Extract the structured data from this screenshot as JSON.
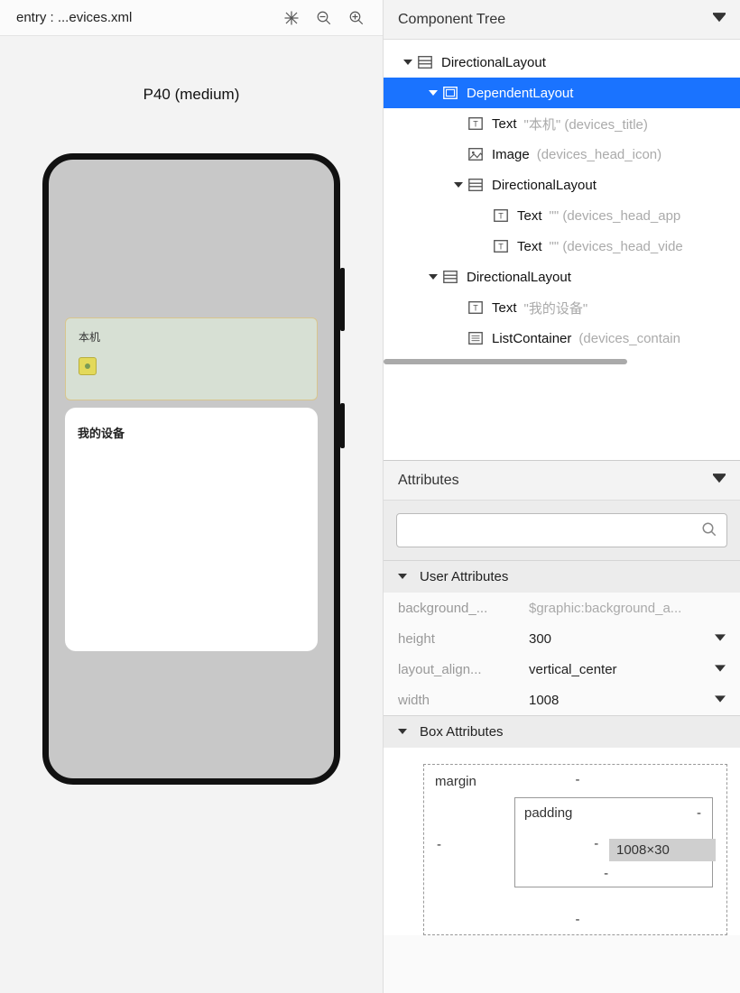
{
  "preview": {
    "filename": "entry : ...evices.xml",
    "device_label": "P40 (medium)",
    "card1_text": "本机",
    "card2_text": "我的设备"
  },
  "tree": {
    "header": "Component Tree",
    "rows": [
      {
        "indent": 0,
        "expand": true,
        "icon": "layout",
        "label": "DirectionalLayout",
        "hint": "",
        "selected": false
      },
      {
        "indent": 1,
        "expand": true,
        "icon": "dep",
        "label": "DependentLayout",
        "hint": "",
        "selected": true
      },
      {
        "indent": 2,
        "expand": false,
        "icon": "text",
        "label": "Text",
        "hint": "\"本机\" (devices_title)",
        "selected": false
      },
      {
        "indent": 2,
        "expand": false,
        "icon": "image",
        "label": "Image",
        "hint": "(devices_head_icon)",
        "selected": false
      },
      {
        "indent": 2,
        "expand": true,
        "icon": "layout",
        "label": "DirectionalLayout",
        "hint": "",
        "selected": false
      },
      {
        "indent": 3,
        "expand": false,
        "icon": "text",
        "label": "Text",
        "hint": "\"\" (devices_head_app",
        "selected": false
      },
      {
        "indent": 3,
        "expand": false,
        "icon": "text",
        "label": "Text",
        "hint": "\"\" (devices_head_vide",
        "selected": false
      },
      {
        "indent": 1,
        "expand": true,
        "icon": "layout",
        "label": "DirectionalLayout",
        "hint": "",
        "selected": false
      },
      {
        "indent": 2,
        "expand": false,
        "icon": "text",
        "label": "Text",
        "hint": "\"我的设备\"",
        "selected": false
      },
      {
        "indent": 2,
        "expand": false,
        "icon": "list",
        "label": "ListContainer",
        "hint": "(devices_contain",
        "selected": false
      }
    ]
  },
  "attributes": {
    "header": "Attributes",
    "search_placeholder": "",
    "user_group": "User Attributes",
    "user_rows": [
      {
        "name": "background_...",
        "value": "$graphic:background_a...",
        "grey": true,
        "dd": false
      },
      {
        "name": "height",
        "value": "300",
        "grey": false,
        "dd": true
      },
      {
        "name": "layout_align...",
        "value": "vertical_center",
        "grey": false,
        "dd": true
      },
      {
        "name": "width",
        "value": "1008",
        "grey": false,
        "dd": true
      }
    ],
    "box_group": "Box Attributes",
    "box": {
      "margin_label": "margin",
      "padding_label": "padding",
      "size_label": "1008×30"
    }
  }
}
